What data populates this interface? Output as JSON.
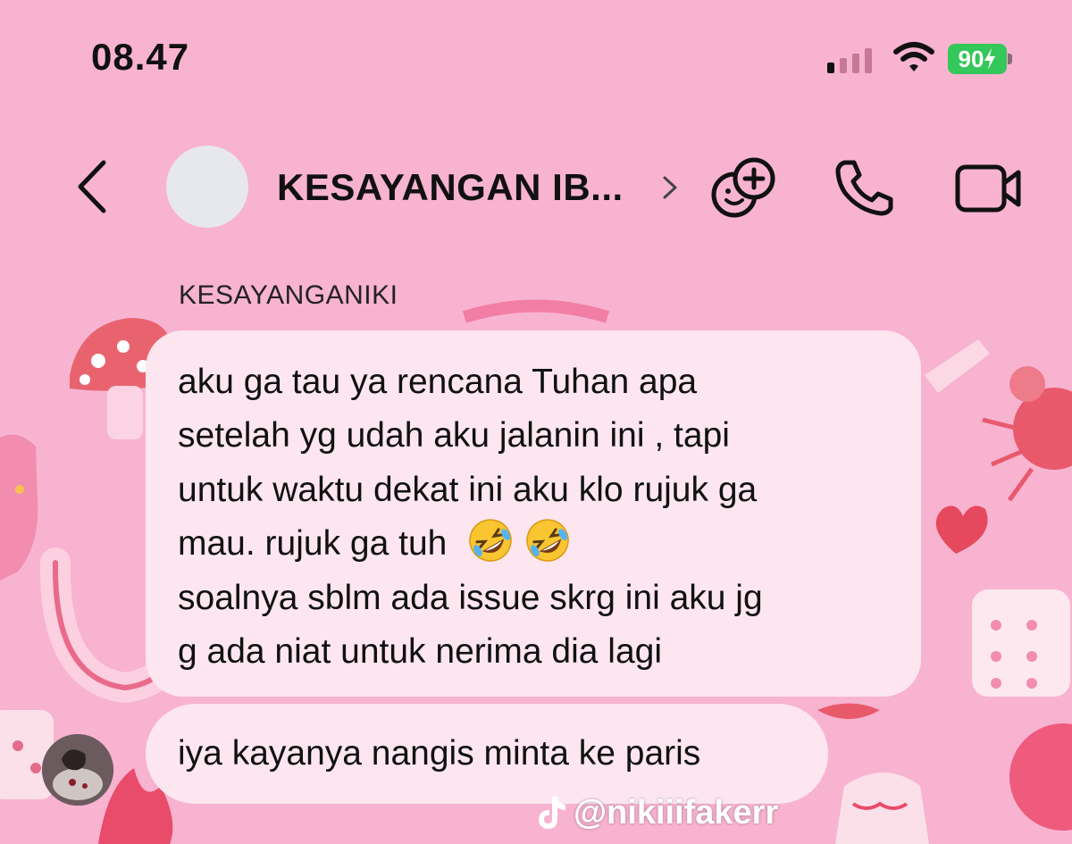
{
  "status_bar": {
    "time": "08.47",
    "battery": "90",
    "icons": [
      "signal-icon",
      "wifi-icon",
      "battery-charging-icon"
    ]
  },
  "header": {
    "back_icon": "chevron-left-icon",
    "title": "KESAYANGAN IB...",
    "title_chevron_icon": "chevron-right-icon",
    "actions": [
      "add-people-icon",
      "phone-icon",
      "video-camera-icon"
    ]
  },
  "messages": [
    {
      "sender": "KESAYANGANIKI",
      "lines": [
        "aku ga tau ya rencana Tuhan apa",
        "setelah yg udah aku jalanin ini , tapi",
        "untuk waktu dekat ini aku klo rujuk ga",
        "mau. rujuk ga tuh",
        "soalnya sblm ada issue skrg ini aku jg",
        "g ada niat untuk nerima dia lagi"
      ],
      "emojis": [
        "rolling-on-floor-laughing-emoji",
        "rolling-on-floor-laughing-emoji"
      ]
    },
    {
      "lines": [
        "iya kayanya nangis minta ke paris"
      ]
    }
  ],
  "watermark": {
    "handle": "@nikiiifakerr",
    "icon": "tiktok-icon"
  },
  "colors": {
    "background": "#f8b3d1",
    "bubble": "#fde6f0",
    "battery": "#34c759",
    "text": "#111111"
  }
}
